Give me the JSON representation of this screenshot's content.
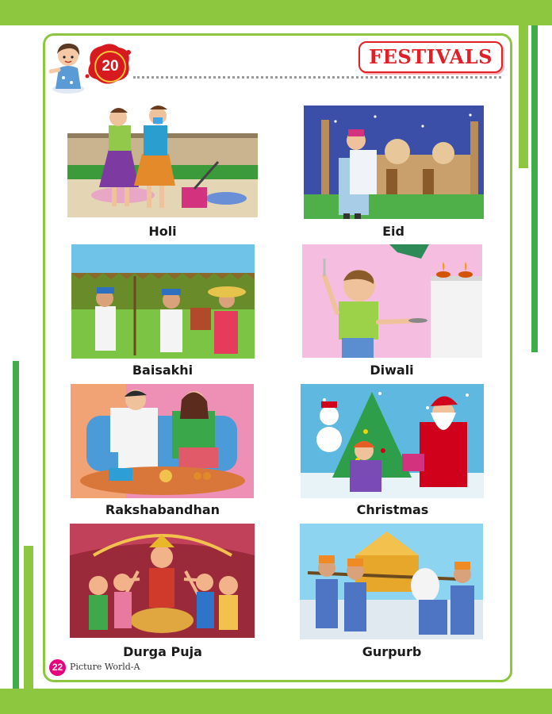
{
  "lesson": {
    "number": "20",
    "title": "FESTIVALS"
  },
  "festivals": [
    {
      "name": "Holi",
      "icon": "holi-illustration"
    },
    {
      "name": "Eid",
      "icon": "eid-illustration"
    },
    {
      "name": "Baisakhi",
      "icon": "baisakhi-illustration"
    },
    {
      "name": "Diwali",
      "icon": "diwali-illustration"
    },
    {
      "name": "Rakshabandhan",
      "icon": "rakshabandhan-illustration"
    },
    {
      "name": "Christmas",
      "icon": "christmas-illustration"
    },
    {
      "name": "Durga Puja",
      "icon": "durga-puja-illustration"
    },
    {
      "name": "Gurpurb",
      "icon": "gurpurb-illustration"
    }
  ],
  "footer": {
    "page_number": "22",
    "book_title": "Picture World-A"
  },
  "colors": {
    "accent_green": "#8dc63f",
    "title_red": "#e21f26",
    "page_badge": "#e6007e"
  }
}
